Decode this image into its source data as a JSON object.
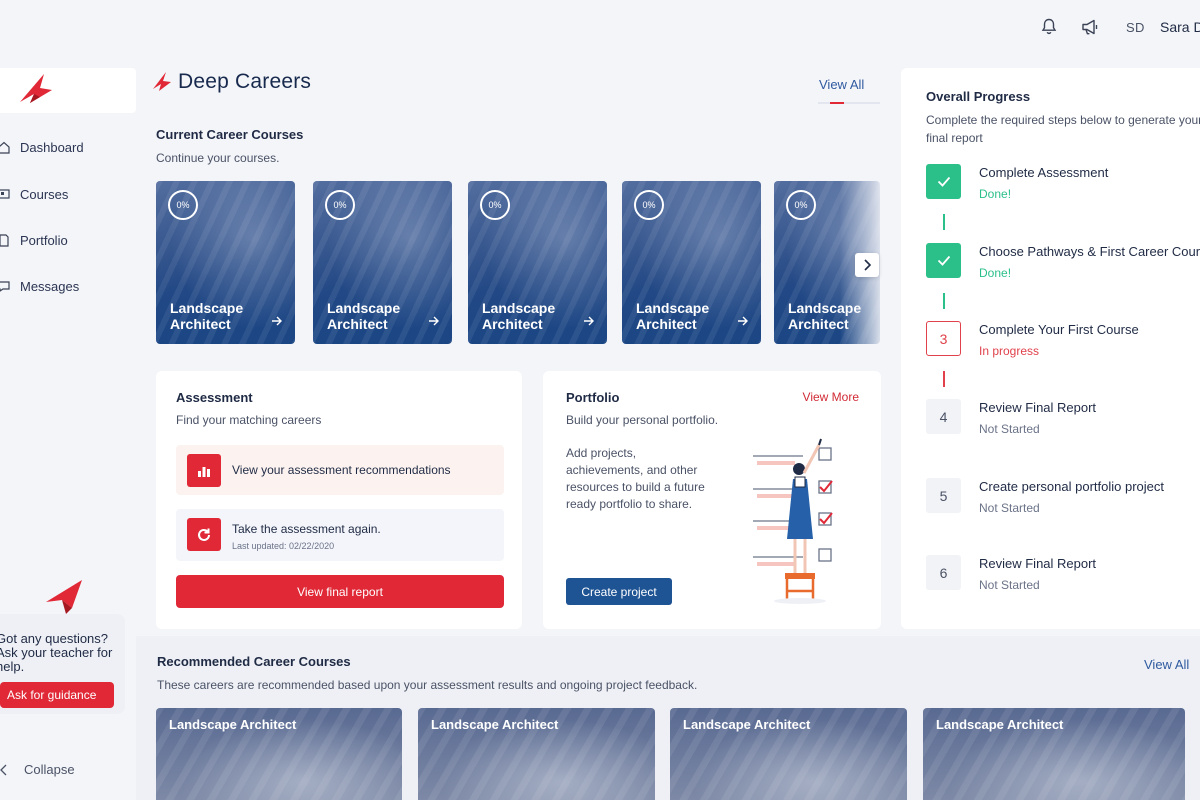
{
  "topbar": {
    "initials": "SD",
    "user_name": "Sara D",
    "icons": [
      "bell-icon",
      "megaphone-icon"
    ]
  },
  "sidebar": {
    "items": [
      {
        "label": "Dashboard",
        "icon": "home-icon"
      },
      {
        "label": "Courses",
        "icon": "book-icon"
      },
      {
        "label": "Portfolio",
        "icon": "document-icon"
      },
      {
        "label": "Messages",
        "icon": "chat-icon"
      }
    ],
    "help_text": "Got any questions? Ask your teacher for help.",
    "help_button": "Ask for guidance",
    "collapse_label": "Collapse"
  },
  "brand": {
    "name": "Deep Careers",
    "view_all": "View All",
    "accent": "#e02836"
  },
  "current_courses": {
    "title": "Current Career Courses",
    "subtitle": "Continue your courses.",
    "cards": [
      {
        "progress": "0%",
        "title": "Landscape Architect"
      },
      {
        "progress": "0%",
        "title": "Landscape Architect"
      },
      {
        "progress": "0%",
        "title": "Landscape Architect"
      },
      {
        "progress": "0%",
        "title": "Landscape Architect"
      },
      {
        "progress": "0%",
        "title": "Landscape Architect"
      }
    ]
  },
  "assessment": {
    "title": "Assessment",
    "subtitle": "Find your matching careers",
    "recommendations_label": "View your assessment recommendations",
    "retake_label": "Take the assessment again.",
    "last_updated": "Last updated: 02/22/2020",
    "report_button": "View final report"
  },
  "portfolio": {
    "title": "Portfolio",
    "view_more": "View More",
    "subtitle": "Build your personal portfolio.",
    "description": "Add projects, achievements, and other resources to build a future ready portfolio to share.",
    "create_button": "Create project"
  },
  "overall_progress": {
    "title": "Overall Progress",
    "description": "Complete the required steps below to generate your final report",
    "steps": [
      {
        "badge": "",
        "title": "Complete Assessment",
        "status": "Done!",
        "state": "done"
      },
      {
        "badge": "",
        "title": "Choose Pathways & First Career Course",
        "status": "Done!",
        "state": "done"
      },
      {
        "badge": "3",
        "title": "Complete Your First Course",
        "status": "In progress",
        "state": "progress"
      },
      {
        "badge": "4",
        "title": "Review Final Report",
        "status": "Not Started",
        "state": "not-started"
      },
      {
        "badge": "5",
        "title": "Create personal portfolio project",
        "status": "Not Started",
        "state": "not-started"
      },
      {
        "badge": "6",
        "title": "Review Final Report",
        "status": "Not Started",
        "state": "not-started"
      }
    ],
    "colors": {
      "done": "#2bbf8a",
      "progress": "#e0414b",
      "not_started": "#6b7388"
    }
  },
  "recommended": {
    "title": "Recommended Career Courses",
    "subtitle": "These careers are recommended based upon your assessment results and ongoing project feedback.",
    "view_all": "View All",
    "cards": [
      {
        "title": "Landscape Architect"
      },
      {
        "title": "Landscape Architect"
      },
      {
        "title": "Landscape Architect"
      },
      {
        "title": "Landscape Architect"
      }
    ]
  }
}
